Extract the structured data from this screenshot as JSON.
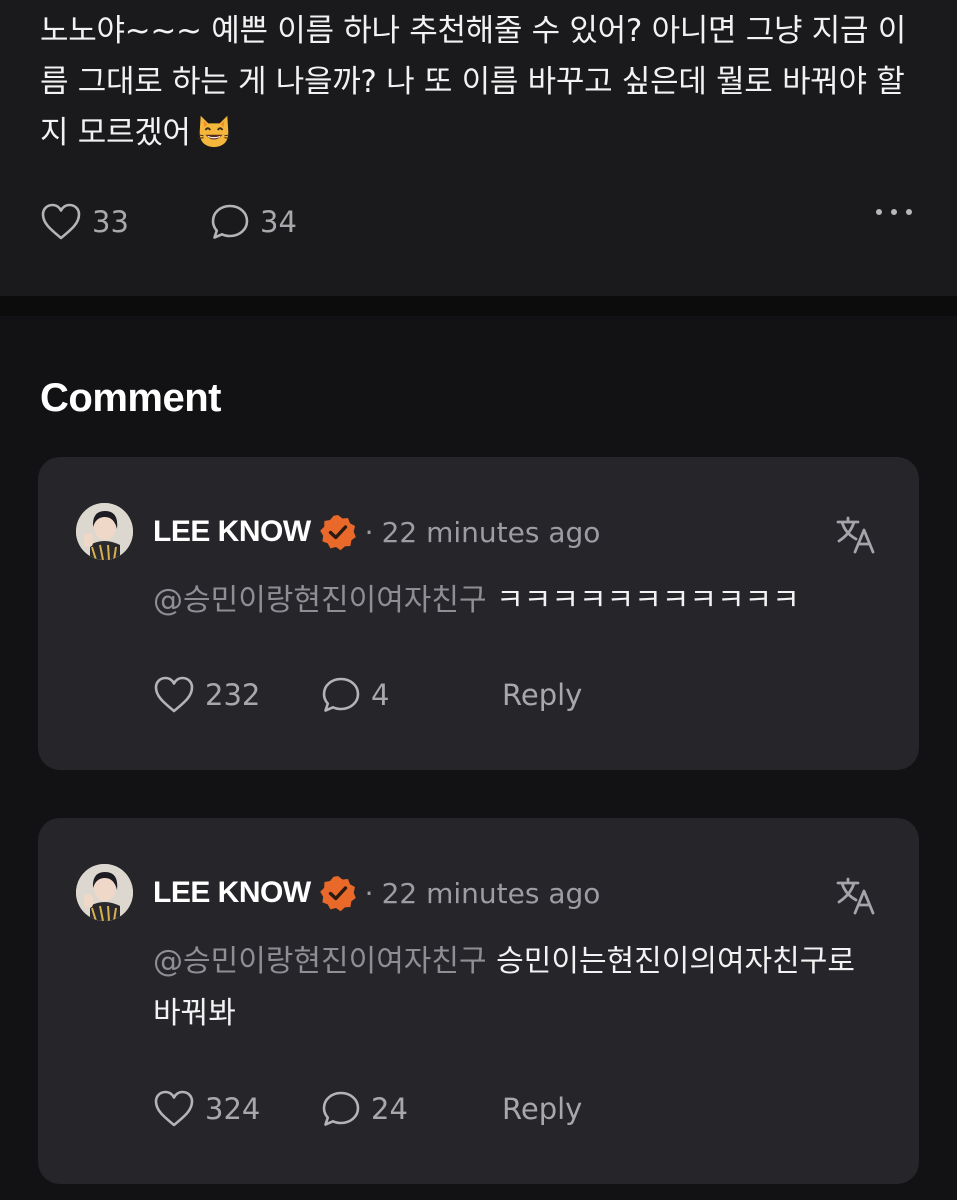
{
  "post": {
    "text": "노노야~~~ 예쁜 이름 하나 추천해줄 수 있어? 아니면 그냥 지금 이름 그대로 하는 게 나을까? 나 또 이름 바꾸고 싶은데 뭘로 바꿔야 할지 모르겠어",
    "emoji": "smiling-cat-face-icon",
    "likes": "33",
    "comments": "34"
  },
  "section_title": "Comment",
  "comments": [
    {
      "author": "LEE KNOW",
      "separator": "·",
      "time": "22 minutes ago",
      "mention": "@승민이랑현진이여자친구",
      "text": " ㅋㅋㅋㅋㅋㅋㅋㅋㅋㅋㅋ",
      "likes": "232",
      "replies": "4",
      "reply_label": "Reply"
    },
    {
      "author": "LEE KNOW",
      "separator": "·",
      "time": "22 minutes ago",
      "mention": "@승민이랑현진이여자친구",
      "text": " 승민이는현진이의여자친구로 바꿔봐",
      "likes": "324",
      "replies": "24",
      "reply_label": "Reply"
    }
  ],
  "colors": {
    "background": "#121214",
    "post_background": "#1a1a1c",
    "card_background": "#25252a",
    "verified_badge": "#e8692a",
    "muted_text": "#9c9ca2"
  }
}
